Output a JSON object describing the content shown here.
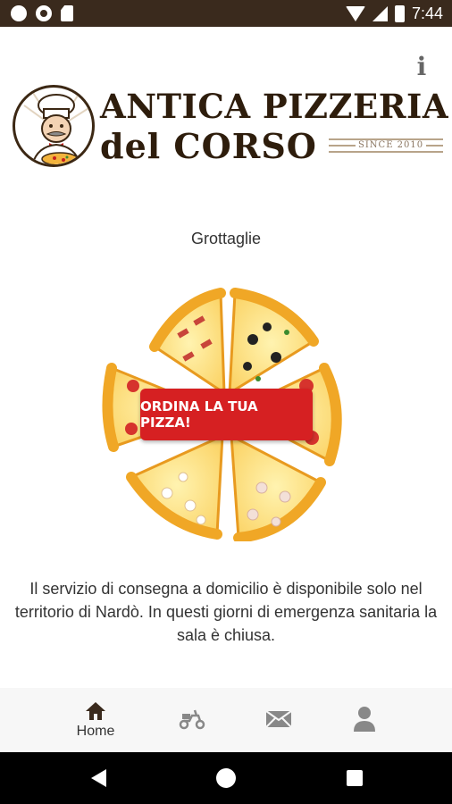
{
  "status_bar": {
    "time": "7:44"
  },
  "logo": {
    "line1": "ANTICA PIZZERIA",
    "line2": "del CORSO",
    "since": "SINCE 2010"
  },
  "city": "Grottaglie",
  "order_button": "ORDINA LA TUA PIZZA!",
  "notice": "Il servizio di consegna a domicilio è disponibile solo nel territorio di Nardò. In questi giorni di emergenza sanitaria la sala è chiusa.",
  "bottom_nav": {
    "items": [
      {
        "label": "Home",
        "icon": "home-icon",
        "active": true
      },
      {
        "label": "",
        "icon": "scooter-icon",
        "active": false
      },
      {
        "label": "",
        "icon": "mail-icon",
        "active": false
      },
      {
        "label": "",
        "icon": "user-icon",
        "active": false
      }
    ]
  },
  "colors": {
    "status_bar": "#3a2a1d",
    "brand_brown": "#2e1d0c",
    "order_red": "#d62022",
    "nav_icon_active": "#3a2a1d",
    "nav_icon_inactive": "#888888"
  }
}
